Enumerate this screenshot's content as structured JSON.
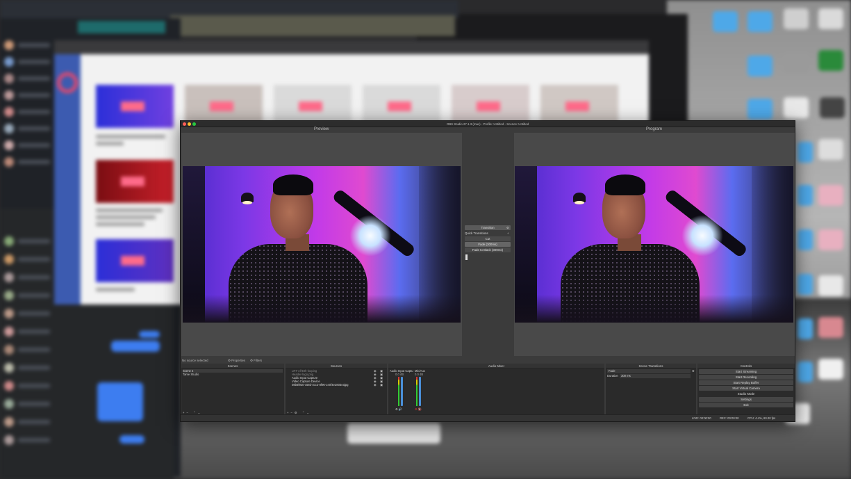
{
  "window": {
    "title": "OBS Studio 27.1.3 (mac) - Profile: Untitled - Scenes: Untitled"
  },
  "preview": {
    "label": "Preview"
  },
  "program": {
    "label": "Program"
  },
  "transition_panel": {
    "transition_button": "Transition",
    "quick_transitions": "Quick Transitions",
    "cut": "Cut",
    "fade": "Fade (300ms)",
    "fade_to_black": "Fade to Black (300ms)"
  },
  "source_bar": {
    "label": "No source selected",
    "properties": "Properties",
    "filters": "Filters"
  },
  "scenes": {
    "header": "Scenes",
    "items": [
      "Scene 2",
      "Tame Studio"
    ]
  },
  "sources": {
    "header": "Sources",
    "items": [
      "LRT-All-Eth-looping",
      "Header-logo.png",
      "Audio Input Capture",
      "Video Capture Device",
      "08b6f920-c58d-4cc2-8f96-1e0f4e2803eajpg"
    ]
  },
  "audio_mixer": {
    "header": "Audio Mixer",
    "channels": [
      {
        "name": "Audio Input Captu",
        "level": "0.0 dB",
        "volume": 0.85,
        "muted": false
      },
      {
        "name": "Mic/Aux",
        "level": "0.0 dB",
        "volume": 0.85,
        "muted": true
      }
    ]
  },
  "scene_transitions": {
    "header": "Scene Transitions",
    "selected": "Fade",
    "duration_label": "Duration",
    "duration_value": "300 ms"
  },
  "controls": {
    "header": "Controls",
    "buttons": [
      "Start Streaming",
      "Start Recording",
      "Start Replay Buffer",
      "Start Virtual Camera",
      "Studio Mode",
      "Settings",
      "Exit"
    ]
  },
  "status": {
    "live": "LIVE: 00:00:00",
    "rec": "REC: 00:00:00",
    "cpu": "CPU: 4.4%, 60.00 fps"
  },
  "colors": {
    "accent": "#4a8fd8",
    "muted": "#e03030",
    "brand_pink": "#e8486a"
  },
  "icons": [
    "close-icon",
    "minimize-icon",
    "maximize-icon",
    "gear-icon",
    "plus-icon",
    "minus-icon",
    "arrow-up-icon",
    "arrow-down-icon",
    "speaker-icon",
    "eye-icon",
    "lock-icon"
  ]
}
